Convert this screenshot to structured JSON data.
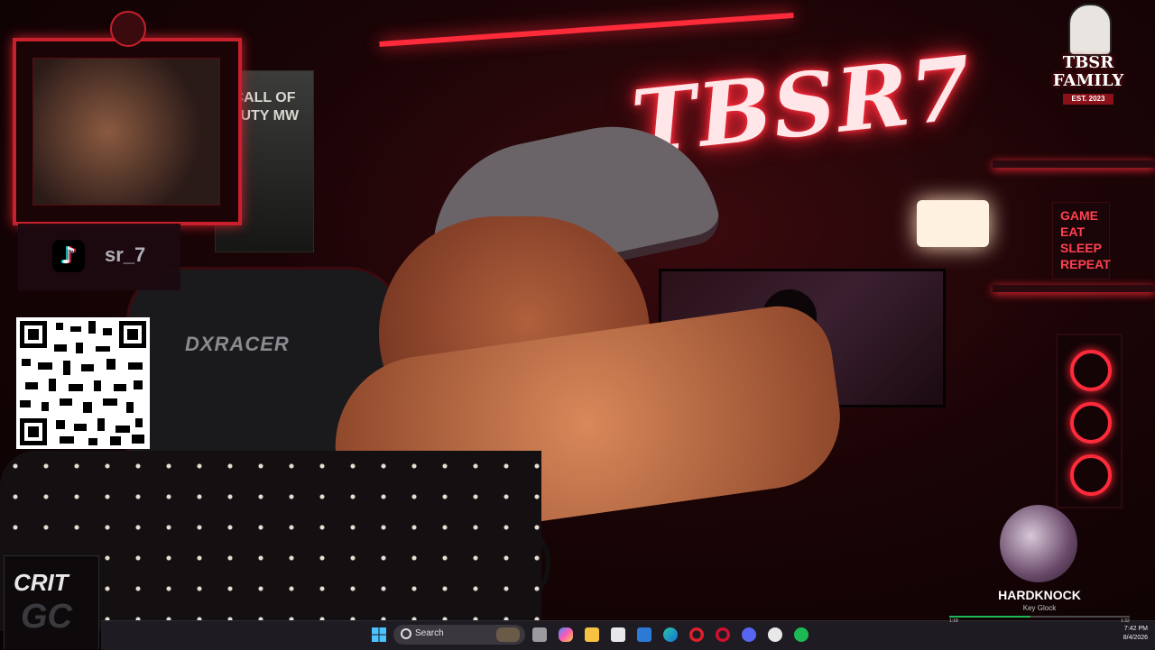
{
  "wallpaper": {
    "neon_sign": "TBSR7",
    "brand_logo": "TBSR FAMILY",
    "brand_est": "EST. 2023",
    "chair_brand": "DXRACER",
    "poster_text": "CALL OF DUTY MW",
    "shelf_sign": [
      "GAME",
      "EAT",
      "SLEEP",
      "REPEAT"
    ],
    "tiktok_handle": "sr_7",
    "crit_logo_top": "CRIT",
    "crit_logo_bottom": "GC"
  },
  "now_playing": {
    "title": "HARDKNOCK",
    "artist": "Key Glock",
    "elapsed": "1:18",
    "duration": "1:32",
    "progress": 0.45
  },
  "taskbar": {
    "search_placeholder": "Search",
    "time": "7:42 PM",
    "date": "8/4/2026",
    "icons": [
      "windows-start-icon",
      "search-icon",
      "task-view-icon",
      "copilot-icon",
      "file-explorer-icon",
      "microsoft-store-icon",
      "mail-icon",
      "edge-icon",
      "opera-icon",
      "opera-gx-icon",
      "discord-icon",
      "github-icon",
      "spotify-icon"
    ]
  },
  "colors": {
    "neon_red": "#ff2a3a",
    "spotify_green": "#1db954",
    "taskbar": "#1e1c22"
  }
}
